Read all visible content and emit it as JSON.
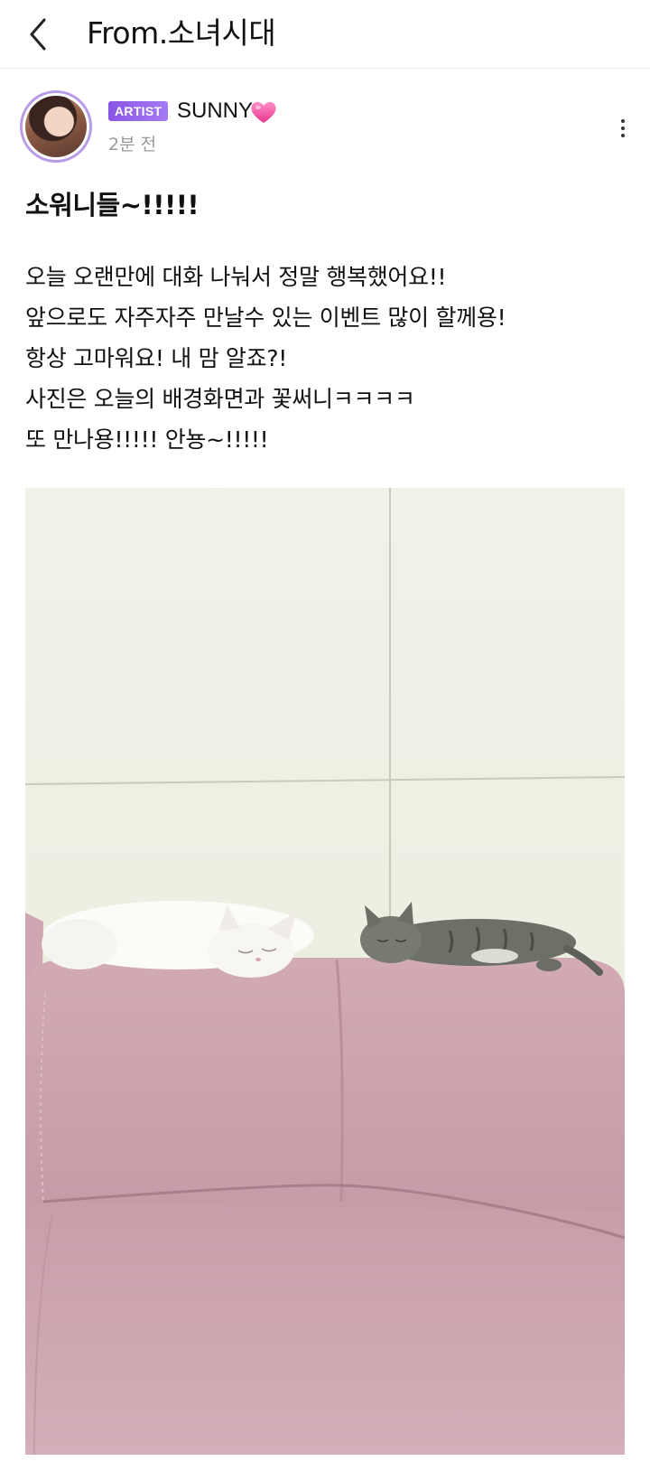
{
  "header": {
    "title": "From.소녀시대",
    "back_icon": "chevron-left-icon"
  },
  "post": {
    "author": {
      "badge": "ARTIST",
      "name": "SUNNY",
      "name_emoji_icon": "pink-heart-icon",
      "avatar_icon": "profile-photo"
    },
    "time": "2분 전",
    "more_icon": "vertical-dots-icon",
    "title": "소워니들~!!!!!",
    "body_lines": [
      "오늘 오랜만에 대화 나눠서 정말 행복했어요!!",
      "앞으로도 자주자주 만날수 있는 이벤트 많이 할께용!",
      "항상 고마워요! 내 맘 알죠?!",
      "사진은 오늘의 배경화면과 꽃써니ㅋㅋㅋㅋ",
      "또 만나용!!!!! 안뇽~!!!!!"
    ],
    "photo": "two cats sleeping on pink sofa"
  },
  "colors": {
    "badge": "#8a55e6",
    "avatar_ring": "#b99be8",
    "time_text": "#9a9a9a",
    "heart": "#f04fa0"
  }
}
